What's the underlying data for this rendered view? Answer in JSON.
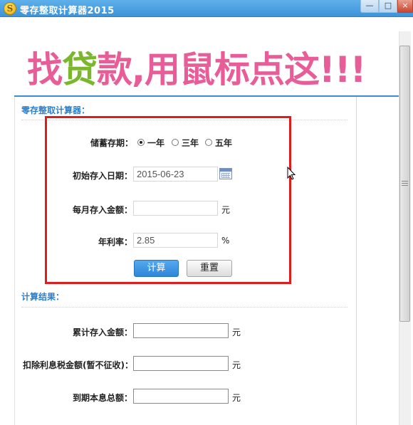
{
  "window": {
    "title": "零存整取计算器2015",
    "icon_glyph": "S",
    "controls": {
      "minimize": "—",
      "maximize": "□",
      "close": "×"
    }
  },
  "banner": {
    "part1": "找",
    "part2": "贷",
    "part3": "款,用鼠标点这!!!"
  },
  "calculator": {
    "section_title": "零存整取计算器：",
    "term_label": "储蓄存期：",
    "term_options": [
      "一年",
      "三年",
      "五年"
    ],
    "term_selected": "一年",
    "start_date_label": "初始存入日期：",
    "start_date_value": "2015-06-23",
    "monthly_label": "每月存入金额：",
    "monthly_value": "",
    "monthly_unit": "元",
    "rate_label": "年利率：",
    "rate_value": "2.85",
    "rate_unit": "%",
    "calc_button": "计算",
    "reset_button": "重置"
  },
  "results": {
    "section_title": "计算结果：",
    "total_deposit_label": "累计存入金额：",
    "total_deposit_unit": "元",
    "tax_label": "扣除利息税金额(暂不征收)：",
    "tax_unit": "元",
    "maturity_label": "到期本息总额：",
    "maturity_unit": "元"
  },
  "colors": {
    "titlebar": "#3d93d9",
    "banner_pink": "#e85d97",
    "banner_green": "#7ab72d",
    "section_blue": "#2d7fcc",
    "highlight_red": "#e01d1d",
    "calc_button": "#2f86d8"
  }
}
